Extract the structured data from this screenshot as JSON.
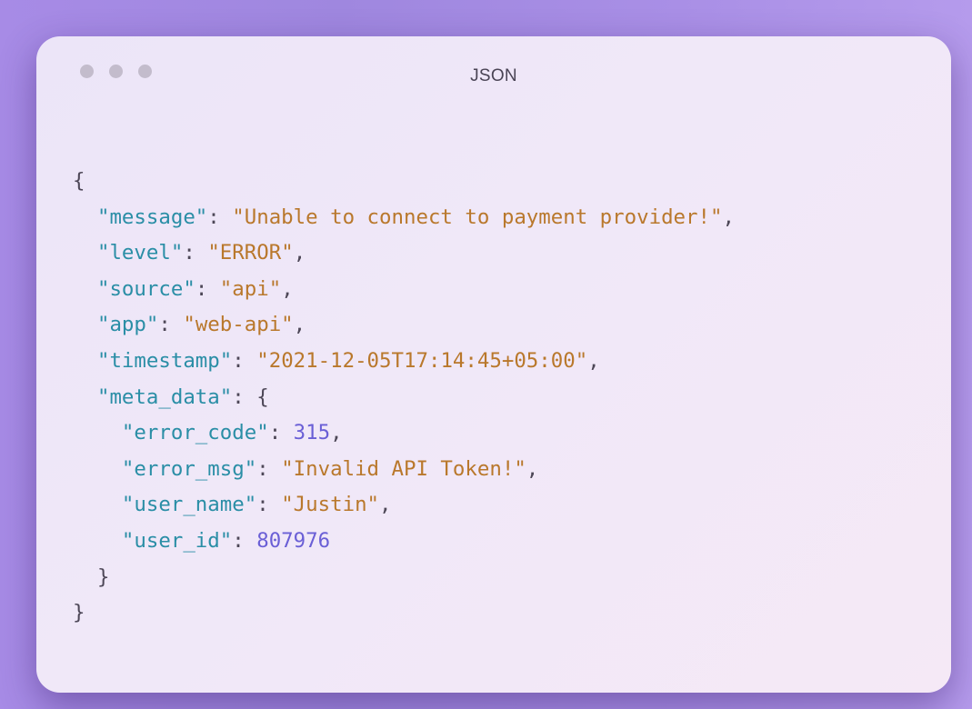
{
  "window": {
    "title": "JSON",
    "controls": [
      "close-dot",
      "minimize-dot",
      "maximize-dot"
    ]
  },
  "colors": {
    "key": "#2a8ea6",
    "string": "#b9782c",
    "number": "#6a5fd6",
    "punctuation": "#4d4757",
    "dot": "#c3bccc"
  },
  "code": {
    "open_brace": "{",
    "close_brace": "}",
    "message_key": "\"message\"",
    "message_value": "\"Unable to connect to payment provider!\"",
    "level_key": "\"level\"",
    "level_value": "\"ERROR\"",
    "source_key": "\"source\"",
    "source_value": "\"api\"",
    "app_key": "\"app\"",
    "app_value": "\"web-api\"",
    "timestamp_key": "\"timestamp\"",
    "timestamp_value": "\"2021-12-05T17:14:45+05:00\"",
    "meta_key": "\"meta_data\"",
    "meta_open": "{",
    "meta_close": "}",
    "error_code_key": "\"error_code\"",
    "error_code_value": "315",
    "error_msg_key": "\"error_msg\"",
    "error_msg_value": "\"Invalid API Token!\"",
    "user_name_key": "\"user_name\"",
    "user_name_value": "\"Justin\"",
    "user_id_key": "\"user_id\"",
    "user_id_value": "807976"
  }
}
